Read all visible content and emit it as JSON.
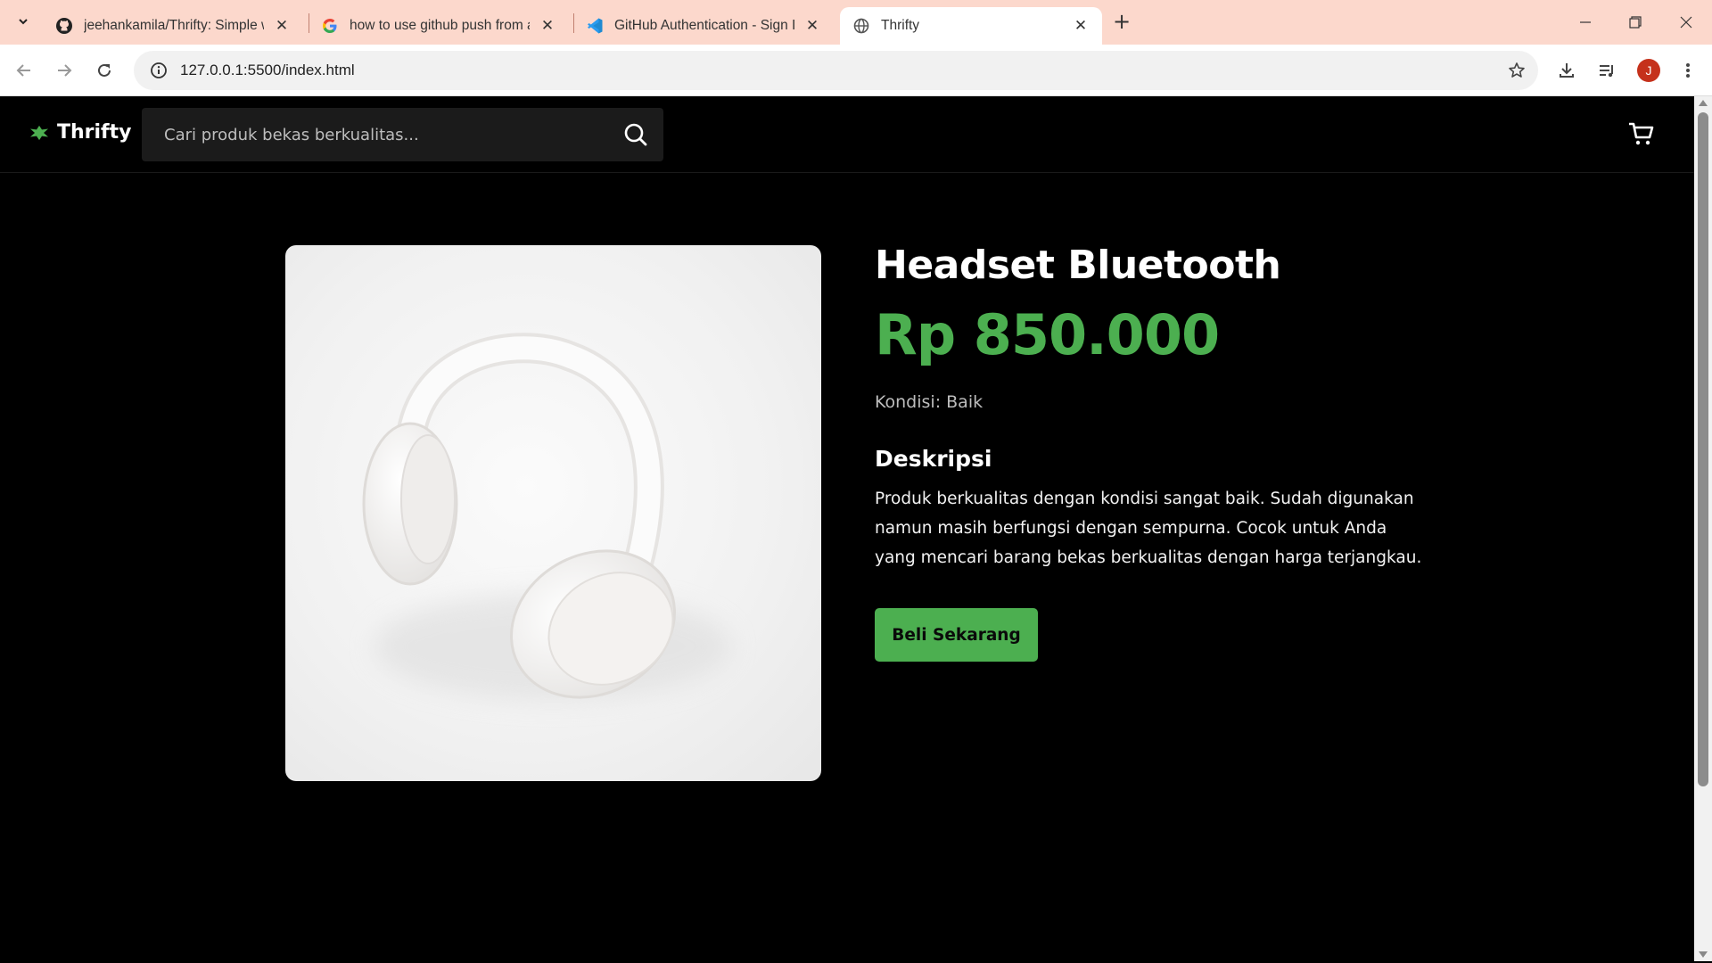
{
  "browser": {
    "tabs": [
      {
        "label": "jeehankamila/Thrifty: Simple web",
        "icon": "github-icon"
      },
      {
        "label": "how to use github push from a",
        "icon": "google-icon"
      },
      {
        "label": "GitHub Authentication - Sign In",
        "icon": "vscode-icon"
      },
      {
        "label": "Thrifty",
        "icon": "globe-icon",
        "active": true
      }
    ],
    "url": "127.0.0.1:5500/index.html",
    "profile_initial": "J",
    "colors": {
      "tabstrip": "#fcd8cc",
      "profile": "#c5311b"
    }
  },
  "site": {
    "brand": "Thrifty",
    "search_placeholder": "Cari produk bekas berkualitas...",
    "colors": {
      "accent": "#4caf50",
      "background": "#000000"
    }
  },
  "product": {
    "title": "Headset Bluetooth",
    "price": "Rp 850.000",
    "condition": "Kondisi: Baik",
    "description_heading": "Deskripsi",
    "description": "Produk berkualitas dengan kondisi sangat baik. Sudah digunakan namun masih berfungsi dengan sempurna. Cocok untuk Anda yang mencari barang bekas berkualitas dengan harga terjangkau.",
    "buy_label": "Beli Sekarang"
  }
}
